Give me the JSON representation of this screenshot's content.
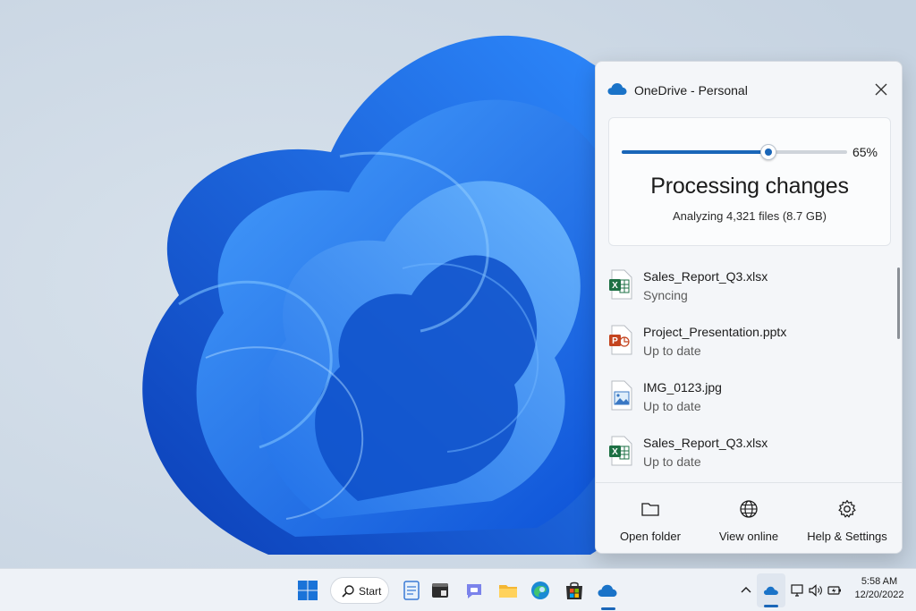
{
  "flyout": {
    "title": "OneDrive - Personal",
    "progress_percent": 65,
    "progress_label": "65%",
    "status_title": "Processing changes",
    "status_subtitle": "Analyzing 4,321 files (8.7 GB)",
    "files": [
      {
        "name": "Sales_Report_Q3.xlsx",
        "status": "Syncing",
        "icon": "excel-icon"
      },
      {
        "name": "Project_Presentation.pptx",
        "status": "Up to date",
        "icon": "powerpoint-icon"
      },
      {
        "name": "IMG_0123.jpg",
        "status": "Up to date",
        "icon": "image-file-icon"
      },
      {
        "name": "Sales_Report_Q3.xlsx",
        "status": "Up to date",
        "icon": "excel-icon"
      }
    ],
    "footer": {
      "open_folder": "Open folder",
      "view_online": "View online",
      "help_settings": "Help & Settings"
    }
  },
  "taskbar": {
    "search_label": "Start",
    "apps": [
      "windows-start-icon",
      "search-icon",
      "notepad-icon",
      "terminal-icon",
      "teams-chat-icon",
      "file-explorer-icon",
      "edge-icon",
      "store-icon",
      "onedrive-icon"
    ],
    "clock_time": "5:58 AM",
    "clock_date": "12/20/2022"
  },
  "colors": {
    "accent": "#1a66b8",
    "excel": "#1d7044",
    "powerpoint": "#c4441f",
    "onedrive": "#1a73c8"
  }
}
